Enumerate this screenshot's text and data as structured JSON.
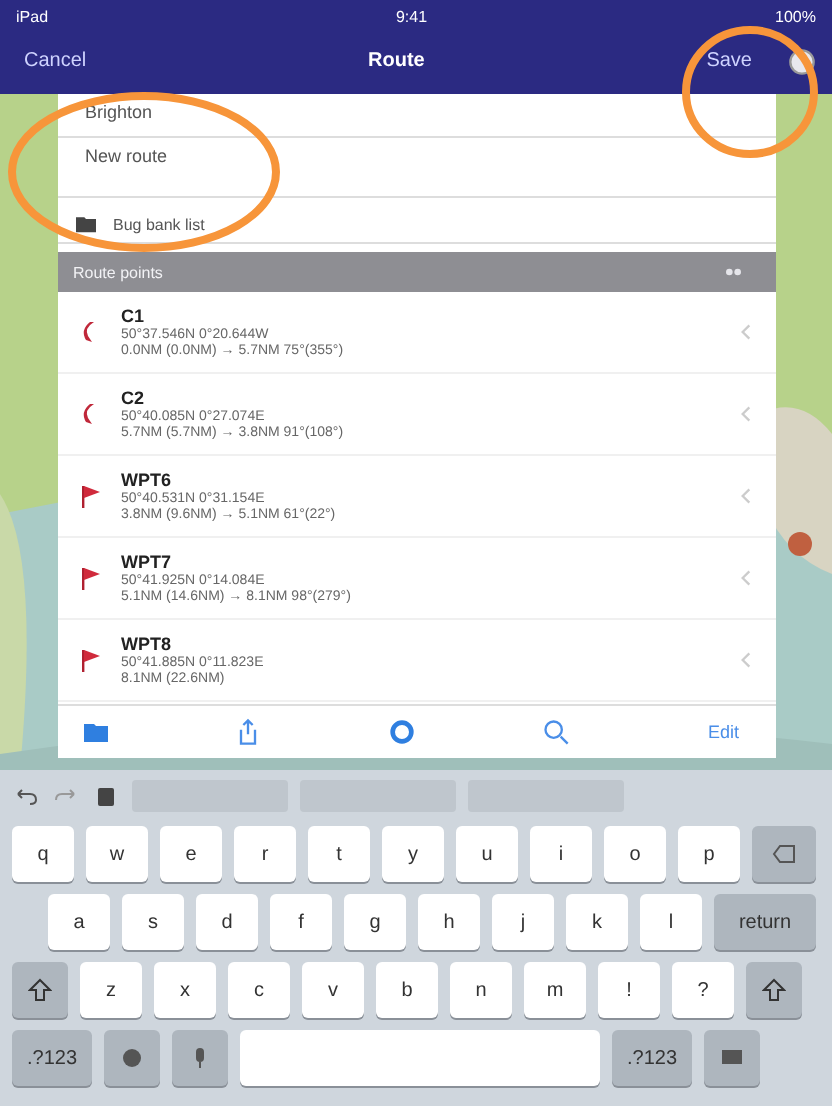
{
  "status_bar": {
    "carrier": "iPad",
    "time": "9:41",
    "battery": "100%"
  },
  "nav_bar": {
    "left": "Cancel",
    "title": "Route",
    "right": "Save"
  },
  "form": {
    "name": "Brighton",
    "notes": "New route",
    "folder": "Bug bank list"
  },
  "section_header": "Route points",
  "points": [
    {
      "name": "C1",
      "kind": "turn",
      "coords": "50°37.546N 0°20.644W",
      "leg": "0.0NM (0.0NM) → 5.7NM 75°(355°)"
    },
    {
      "name": "C2",
      "kind": "turn",
      "coords": "50°40.085N 0°27.074E",
      "leg": "5.7NM (5.7NM) → 3.8NM 91°(108°)"
    },
    {
      "name": "WPT6",
      "kind": "flag",
      "coords": "50°40.531N 0°31.154E",
      "leg": "3.8NM (9.6NM) → 5.1NM 61°(22°)"
    },
    {
      "name": "WPT7",
      "kind": "flag",
      "coords": "50°41.925N 0°14.084E",
      "leg": "5.1NM (14.6NM) → 8.1NM 98°(279°)"
    },
    {
      "name": "WPT8",
      "kind": "flag",
      "coords": "50°41.885N 0°11.823E",
      "leg": "8.1NM (22.6NM)"
    }
  ],
  "toolbar": {
    "edit": "Edit"
  },
  "keyboard": {
    "rows": [
      [
        "q",
        "w",
        "e",
        "r",
        "t",
        "y",
        "u",
        "i",
        "o",
        "p"
      ],
      [
        "a",
        "s",
        "d",
        "f",
        "g",
        "h",
        "j",
        "k",
        "l"
      ],
      [
        "z",
        "x",
        "c",
        "v",
        "b",
        "n",
        "m",
        "!",
        "?"
      ]
    ],
    "return": "return",
    "numbers_left": ".?123",
    "numbers_right": ".?123"
  }
}
